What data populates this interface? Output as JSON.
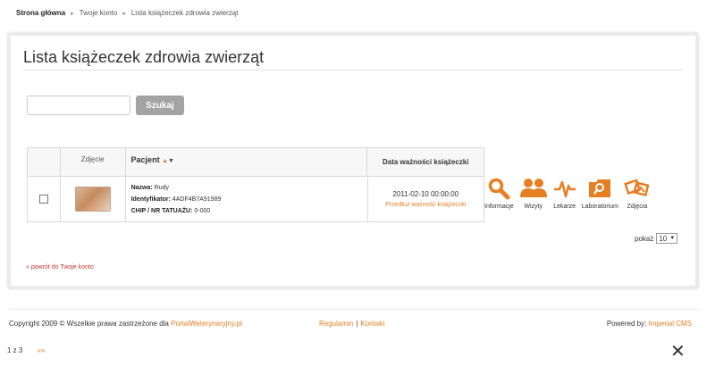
{
  "breadcrumb": {
    "home": "Strona główna",
    "account": "Twoje konto",
    "current": "Lista książeczek zdrowia zwierząt"
  },
  "page_title": "Lista książeczek zdrowia zwierząt",
  "search": {
    "value": "",
    "button_label": "Szukaj"
  },
  "table": {
    "headers": {
      "photo": "Zdjęcie",
      "patient": "Pacjent",
      "validity": "Data ważności książeczki"
    },
    "rows": [
      {
        "name_label": "Nazwa:",
        "name_value": "Rudy",
        "id_label": "Identyfikator:",
        "id_value": "4ADF4B7A91989",
        "chip_label": "CHIP / NR TATUAŻU:",
        "chip_value": "0-000",
        "date": "2011-02-10 00:00:00",
        "extend_link": "Przedłuż ważność książeczki"
      }
    ]
  },
  "actions": [
    {
      "icon": "magnifier-icon",
      "label": "Informacje"
    },
    {
      "icon": "people-icon",
      "label": "Wizyty"
    },
    {
      "icon": "heartbeat-icon",
      "label": "Lekarze"
    },
    {
      "icon": "lab-icon",
      "label": "Laboratorium"
    },
    {
      "icon": "photos-icon",
      "label": "Zdjęcia"
    }
  ],
  "pager": {
    "label": "pokaż",
    "value": "10"
  },
  "back_link": "« powrót do Twoje konto",
  "footer": {
    "copyright_prefix": "Copyright 2009 © Wszelkie prawa zastrzeżone dla",
    "portal": "PortalWeterynaryjny.pl",
    "links": [
      "Regulamin",
      "Kontakt"
    ],
    "powered_prefix": "Powered by:",
    "powered_cms": "Imperial CMS"
  },
  "pages": {
    "list": "1 z 3",
    "next": "»»"
  },
  "close": "✕",
  "colors": {
    "accent": "#e67e22",
    "button": "#a3a3a3",
    "border": "#d9d9d9"
  }
}
